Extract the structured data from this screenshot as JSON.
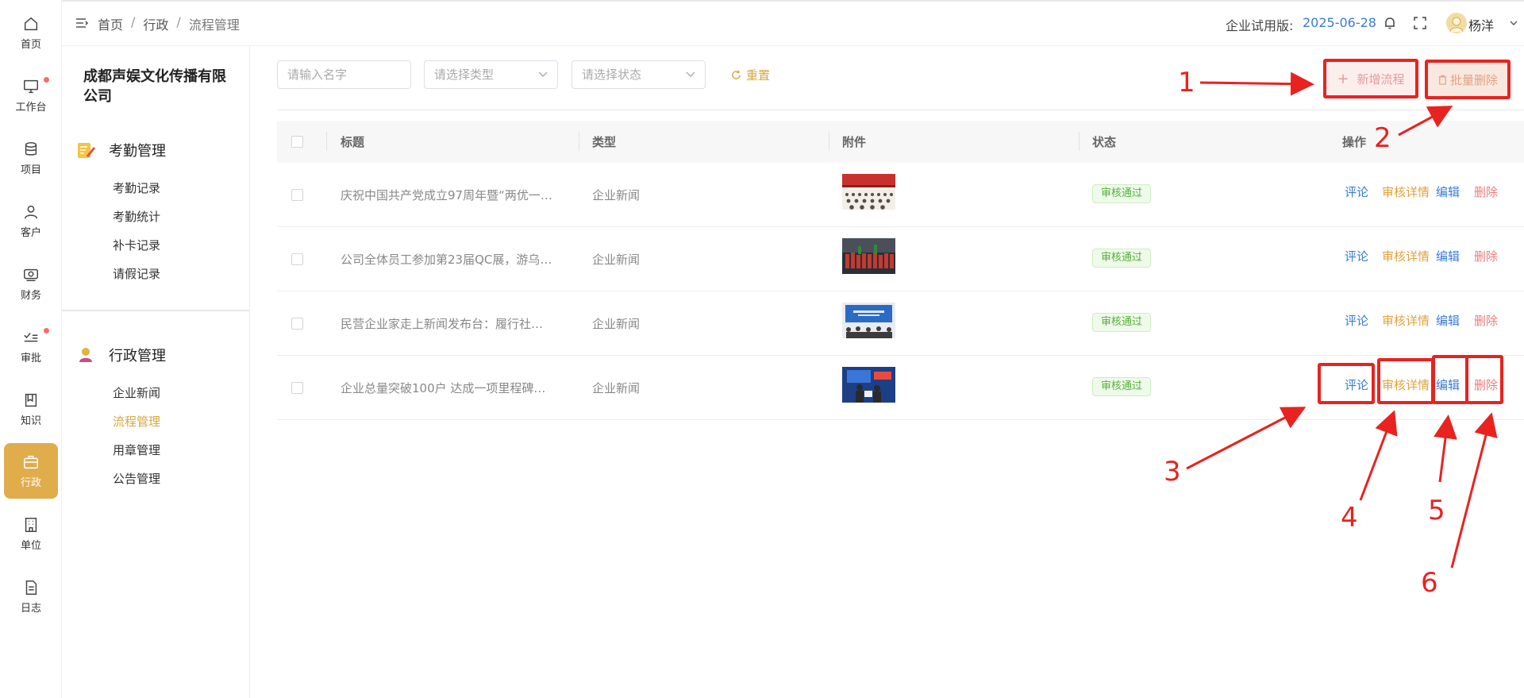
{
  "rail": {
    "items": [
      {
        "label": "首页",
        "icon": "home-icon"
      },
      {
        "label": "工作台",
        "icon": "monitor-icon",
        "badge": true
      },
      {
        "label": "项目",
        "icon": "database-icon"
      },
      {
        "label": "客户",
        "icon": "user-icon"
      },
      {
        "label": "财务",
        "icon": "finance-icon"
      },
      {
        "label": "审批",
        "icon": "approval-icon",
        "badge": true
      },
      {
        "label": "知识",
        "icon": "book-icon"
      },
      {
        "label": "行政",
        "icon": "briefcase-icon",
        "active": true
      },
      {
        "label": "单位",
        "icon": "building-icon"
      },
      {
        "label": "日志",
        "icon": "document-icon"
      }
    ]
  },
  "sidebar": {
    "company": "成都声娱文化传播有限公司",
    "groups": [
      {
        "title": "考勤管理",
        "icon": "attendance-icon",
        "items": [
          "考勤记录",
          "考勤统计",
          "补卡记录",
          "请假记录"
        ]
      },
      {
        "title": "行政管理",
        "icon": "admin-icon",
        "items": [
          "企业新闻",
          "流程管理",
          "用章管理",
          "公告管理"
        ],
        "active_index": 1
      }
    ]
  },
  "header": {
    "breadcrumb": [
      "首页",
      "行政",
      "流程管理"
    ],
    "separator": "/",
    "trial_label": "企业试用版:",
    "trial_date": "2025-06-28",
    "username": "杨洋"
  },
  "filters": {
    "name_placeholder": "请输入名字",
    "type_placeholder": "请选择类型",
    "status_placeholder": "请选择状态",
    "reset_label": "重置"
  },
  "actions": {
    "add_label": "新增流程",
    "batch_delete_label": "批量删除"
  },
  "table": {
    "columns": [
      "标题",
      "类型",
      "附件",
      "状态",
      "操作"
    ],
    "ops": {
      "comment": "评论",
      "detail": "审核详情",
      "edit": "编辑",
      "delete": "删除"
    },
    "rows": [
      {
        "title": "庆祝中国共产党成立97周年暨“两优一…",
        "type": "企业新闻",
        "status": "审核通过"
      },
      {
        "title": "公司全体员工参加第23届QC展，游乌…",
        "type": "企业新闻",
        "status": "审核通过"
      },
      {
        "title": "民营企业家走上新闻发布台：履行社…",
        "type": "企业新闻",
        "status": "审核通过"
      },
      {
        "title": "企业总量突破100户 达成一项里程碑…",
        "type": "企业新闻",
        "status": "审核通过"
      }
    ]
  },
  "annotations": [
    "1",
    "2",
    "3",
    "4",
    "5",
    "6"
  ],
  "colors": {
    "accent": "#e0ac4c",
    "link": "#3a7bd5",
    "warning": "#e0a23e",
    "danger": "#ef7b7b",
    "success": "#55b03a",
    "annotation": "#e8231f"
  }
}
